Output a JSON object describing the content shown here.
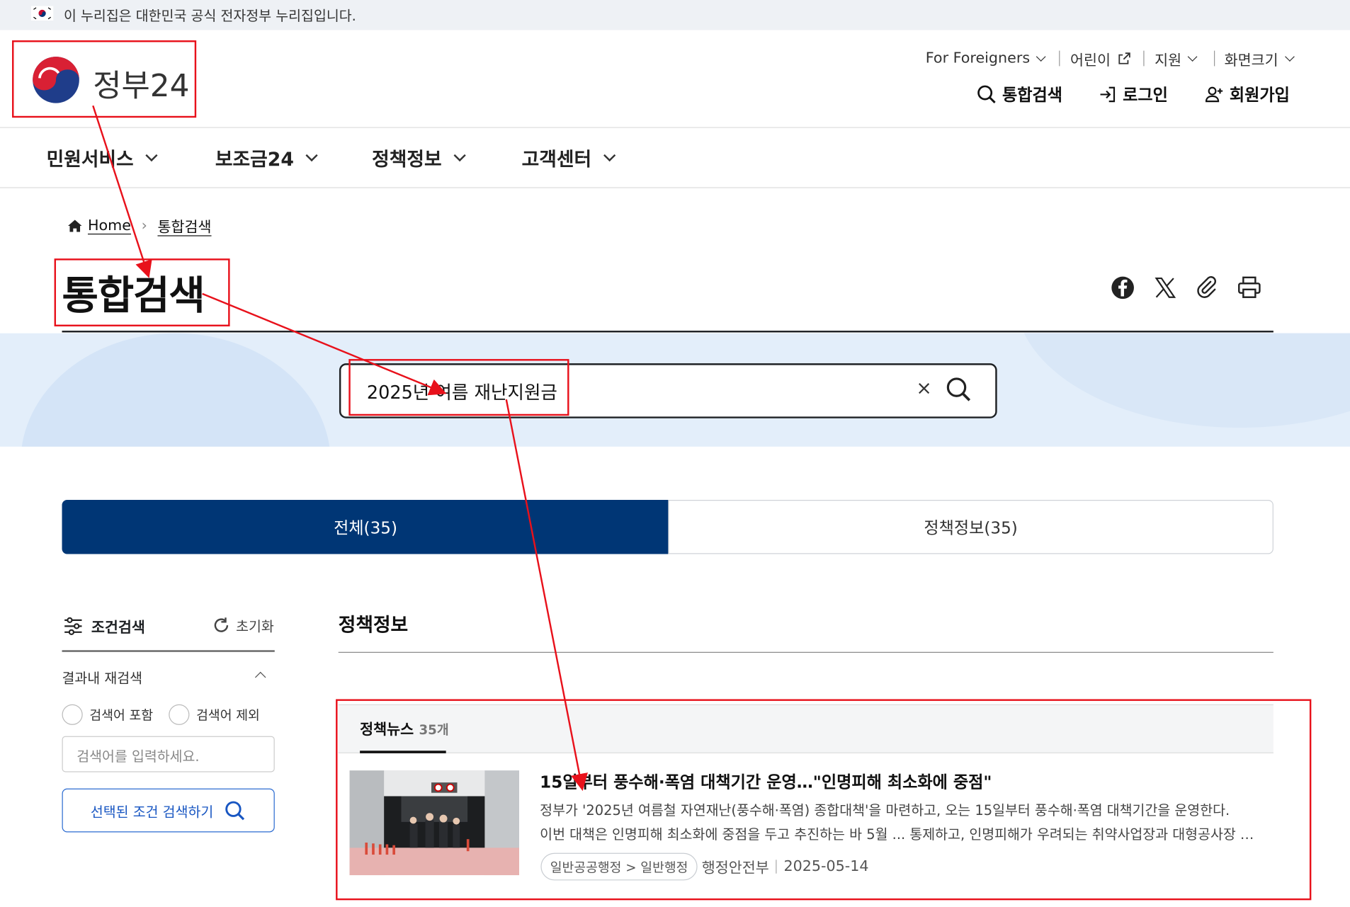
{
  "gov_banner": {
    "text": "이 누리집은 대한민국 공식 전자정부 누리집입니다."
  },
  "brand": {
    "logo_text": "정부24"
  },
  "utility_menu": [
    {
      "label": "For Foreigners",
      "icon": "chevron-down-icon"
    },
    {
      "label": "어린이",
      "icon": "external-link-icon"
    },
    {
      "label": "지원",
      "icon": "chevron-down-icon"
    },
    {
      "label": "화면크기",
      "icon": "chevron-down-icon"
    }
  ],
  "header_actions": [
    {
      "label": "통합검색",
      "icon": "search-icon"
    },
    {
      "label": "로그인",
      "icon": "login-icon"
    },
    {
      "label": "회원가입",
      "icon": "user-plus-icon"
    }
  ],
  "gnb": [
    "민원서비스",
    "보조금24",
    "정책정보",
    "고객센터"
  ],
  "breadcrumb": {
    "home": "Home",
    "current": "통합검색"
  },
  "page_title": "통합검색",
  "share_icons": [
    "facebook-icon",
    "x-icon",
    "link-icon",
    "print-icon"
  ],
  "search": {
    "query": "2025년 여름 재난지원금",
    "clear": "×"
  },
  "tabs": [
    {
      "label": "전체(35)",
      "active": true
    },
    {
      "label": "정책정보(35)",
      "active": false
    }
  ],
  "sidebar": {
    "title": "조건검색",
    "reset": "초기화",
    "refine_title": "결과내 재검색",
    "include_label": "검색어 포함",
    "exclude_label": "검색어 제외",
    "input_placeholder": "검색어를 입력하세요.",
    "submit_label": "선택된 조건 검색하기"
  },
  "section": {
    "title": "정책정보"
  },
  "news": {
    "tab_label": "정책뉴스",
    "count": "35개",
    "article": {
      "title": "15일부터 풍수해·폭염 대책기간 운영…\"인명피해 최소화에 중점\"",
      "desc_line1": "정부가 '2025년 여름철 자연재난(풍수해·폭염) 종합대책'을 마련하고, 오는 15일부터 풍수해·폭염 대책기간을 운영한다.",
      "desc_line2": "이번 대책은 인명피해 최소화에 중점을 두고 추진하는 바 5월 ... 통제하고, 인명피해가 우려되는 취약사업장과 대형공사장 등을 집중 점검한다.",
      "category": "일반공공행정 > 일반행정",
      "agency": "행정안전부",
      "date": "2025-05-14"
    }
  },
  "colors": {
    "primary": "#003675",
    "band": "#e3eefa",
    "annotation": "#e8111b",
    "button_text": "#1856c2"
  }
}
